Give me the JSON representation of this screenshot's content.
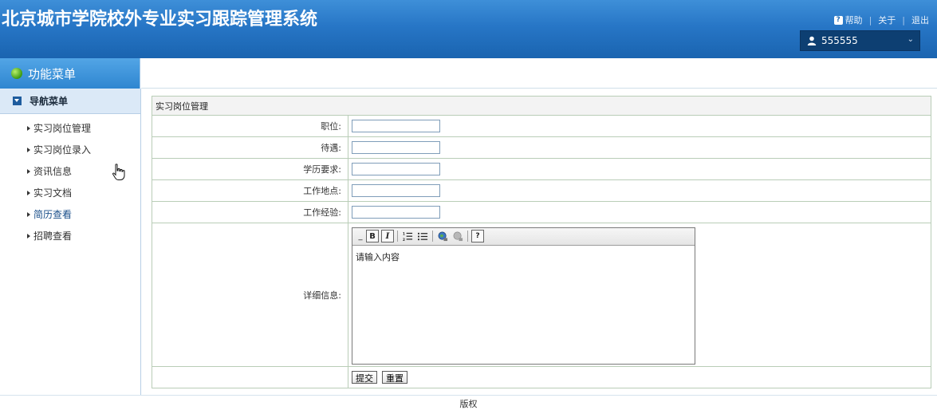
{
  "header": {
    "title": "北京城市学院校外专业实习跟踪管理系统",
    "links": {
      "help": "帮助",
      "about": "关于",
      "logout": "退出"
    },
    "user": {
      "name": "555555"
    }
  },
  "sidebar": {
    "heading": "功能菜单",
    "group_label": "导航菜单",
    "items": [
      {
        "label": "实习岗位管理"
      },
      {
        "label": "实习岗位录入"
      },
      {
        "label": "资讯信息"
      },
      {
        "label": "实习文档"
      },
      {
        "label": "简历查看"
      },
      {
        "label": "招聘查看"
      }
    ]
  },
  "form": {
    "title": "实习岗位管理",
    "fields": [
      {
        "label": "职位:",
        "value": ""
      },
      {
        "label": "待遇:",
        "value": ""
      },
      {
        "label": "学历要求:",
        "value": ""
      },
      {
        "label": "工作地点:",
        "value": ""
      },
      {
        "label": "工作经验:",
        "value": ""
      }
    ],
    "detail_label": "详细信息:",
    "editor_placeholder": "请输入内容",
    "toolbar": {
      "bold": "B",
      "italic": "I",
      "help": "?"
    },
    "submit_label": "提交",
    "reset_label": "重置"
  },
  "footer": {
    "text": "版权"
  },
  "colors": {
    "header_blue": "#2776c6",
    "user_box": "#0d3f72",
    "nav_group_bg": "#dbe9f7"
  }
}
